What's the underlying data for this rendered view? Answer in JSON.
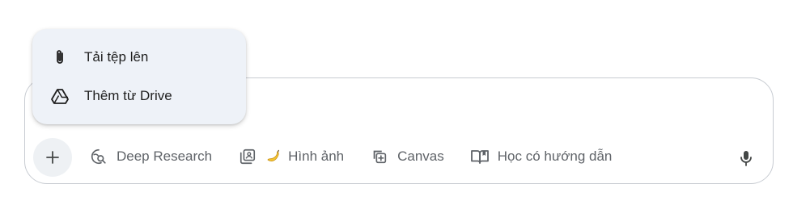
{
  "composer": {
    "plus_icon": "plus-icon",
    "tools": [
      {
        "label": "Deep Research",
        "icon": "deep-research-icon"
      },
      {
        "label": "Hình ảnh",
        "icon": "image-gallery-icon",
        "emoji_icon": "banana-icon"
      },
      {
        "label": "Canvas",
        "icon": "canvas-icon"
      },
      {
        "label": "Học có hướng dẫn",
        "icon": "open-book-icon"
      }
    ],
    "mic_icon": "microphone-icon"
  },
  "menu": {
    "items": [
      {
        "label": "Tải tệp lên",
        "icon": "paperclip-icon"
      },
      {
        "label": "Thêm từ Drive",
        "icon": "drive-icon"
      }
    ]
  },
  "colors": {
    "menu_bg": "#eef2f8",
    "plus_bg": "#eef1f4",
    "border": "#c8ccd2",
    "tool_text": "#5f6368",
    "menu_text": "#1f1f1f"
  }
}
